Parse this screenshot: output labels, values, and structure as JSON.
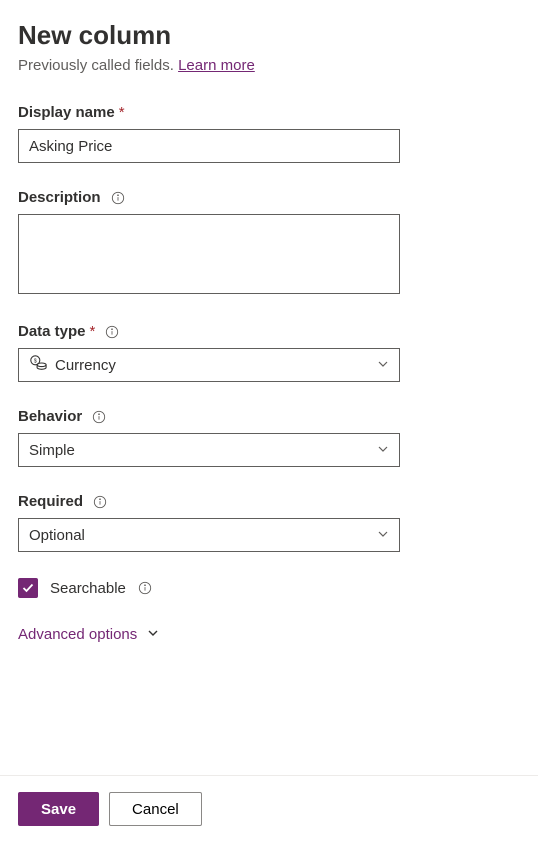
{
  "header": {
    "title": "New column",
    "subtitle_prefix": "Previously called fields. ",
    "learn_more": "Learn more"
  },
  "fields": {
    "display_name": {
      "label": "Display name",
      "required_mark": "*",
      "value": "Asking Price"
    },
    "description": {
      "label": "Description",
      "value": ""
    },
    "data_type": {
      "label": "Data type",
      "required_mark": "*",
      "value": "Currency"
    },
    "behavior": {
      "label": "Behavior",
      "value": "Simple"
    },
    "required": {
      "label": "Required",
      "value": "Optional"
    },
    "searchable": {
      "label": "Searchable",
      "checked": true
    }
  },
  "advanced": {
    "label": "Advanced options"
  },
  "footer": {
    "save": "Save",
    "cancel": "Cancel"
  }
}
